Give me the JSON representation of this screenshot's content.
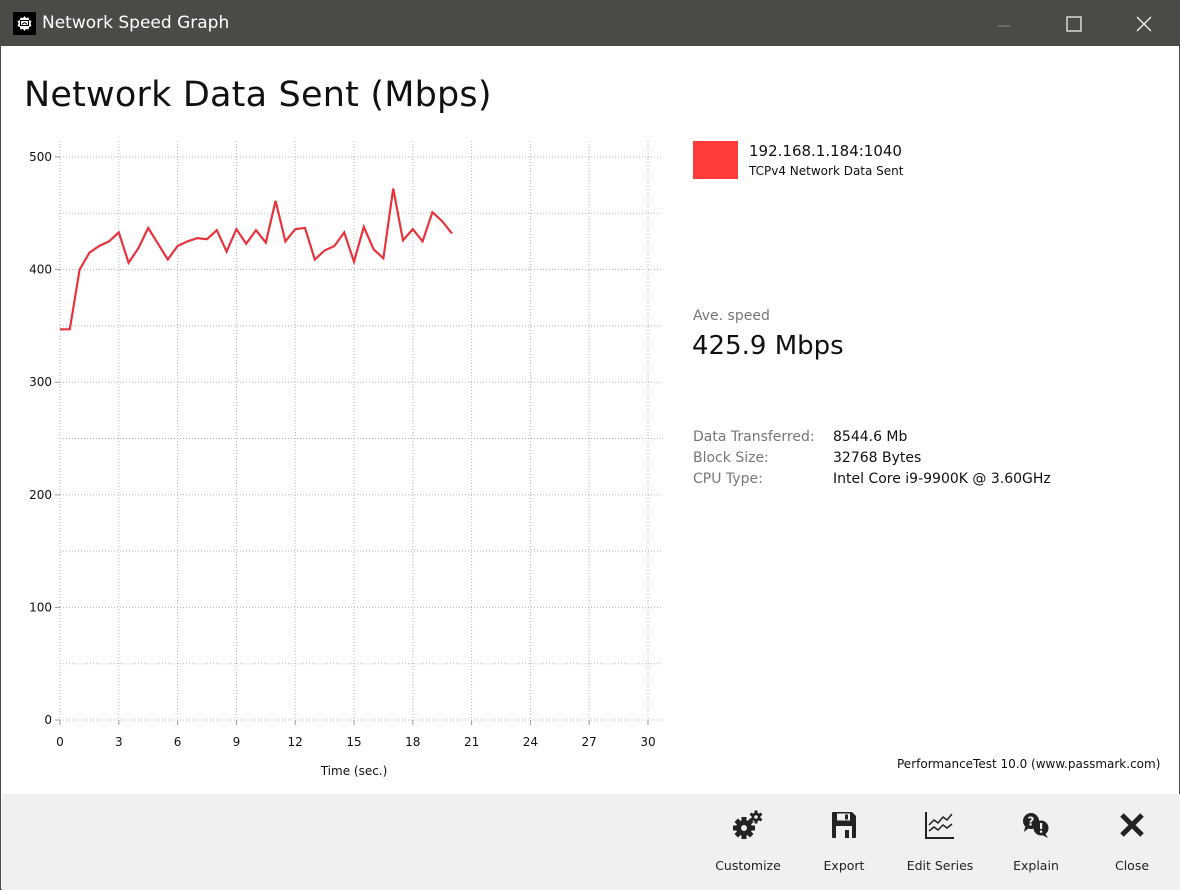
{
  "window": {
    "title": "Network Speed Graph",
    "icon": "passmark-gear-icon",
    "controls": [
      "minimize",
      "maximize",
      "close"
    ]
  },
  "page_title": "Network Data Sent (Mbps)",
  "legend": {
    "series_name": "192.168.1.184:1040",
    "series_desc": "TCPv4 Network Data Sent",
    "color": "#ff3c3c"
  },
  "stats": {
    "ave_label": "Ave. speed",
    "ave_value": "425.9 Mbps",
    "rows": [
      {
        "key": "Data Transferred:",
        "value": "8544.6 Mb"
      },
      {
        "key": "Block Size:",
        "value": "32768 Bytes"
      },
      {
        "key": "CPU Type:",
        "value": "Intel Core i9-9900K @ 3.60GHz"
      }
    ]
  },
  "credit": "PerformanceTest 10.0 (www.passmark.com)",
  "toolbar": [
    {
      "label": "Customize",
      "icon": "gears-icon"
    },
    {
      "label": "Export",
      "icon": "floppy-disk-icon"
    },
    {
      "label": "Edit Series",
      "icon": "line-chart-icon"
    },
    {
      "label": "Explain",
      "icon": "question-exclamation-icon"
    },
    {
      "label": "Close",
      "icon": "close-icon"
    }
  ],
  "chart_data": {
    "type": "line",
    "title": "Network Data Sent (Mbps)",
    "xlabel": "Time (sec.)",
    "ylabel": "",
    "xlim": [
      0,
      30
    ],
    "ylim": [
      0,
      500
    ],
    "xticks": [
      0,
      3,
      6,
      9,
      12,
      15,
      18,
      21,
      24,
      27,
      30
    ],
    "yticks": [
      0,
      100,
      200,
      300,
      400,
      500
    ],
    "yminor_step": 50,
    "grid": true,
    "legend": "right",
    "series": [
      {
        "name": "192.168.1.184:1040",
        "color": "#e8333d",
        "x": [
          0,
          0.5,
          1,
          1.5,
          2,
          2.5,
          3,
          3.5,
          4,
          4.5,
          5,
          5.5,
          6,
          6.5,
          7,
          7.5,
          8,
          8.5,
          9,
          9.5,
          10,
          10.5,
          11,
          11.5,
          12,
          12.5,
          13,
          13.5,
          14,
          14.5,
          15,
          15.5,
          16,
          16.5,
          17,
          17.5,
          18,
          18.5,
          19,
          19.5,
          20
        ],
        "values": [
          347,
          347,
          400,
          415,
          421,
          425,
          433,
          406,
          419,
          437,
          423,
          409,
          421,
          425,
          428,
          427,
          435,
          416,
          436,
          423,
          435,
          424,
          461,
          425,
          436,
          437,
          409,
          417,
          421,
          433,
          407,
          438,
          418,
          410,
          472,
          426,
          436,
          425,
          451,
          443,
          432
        ]
      }
    ]
  }
}
